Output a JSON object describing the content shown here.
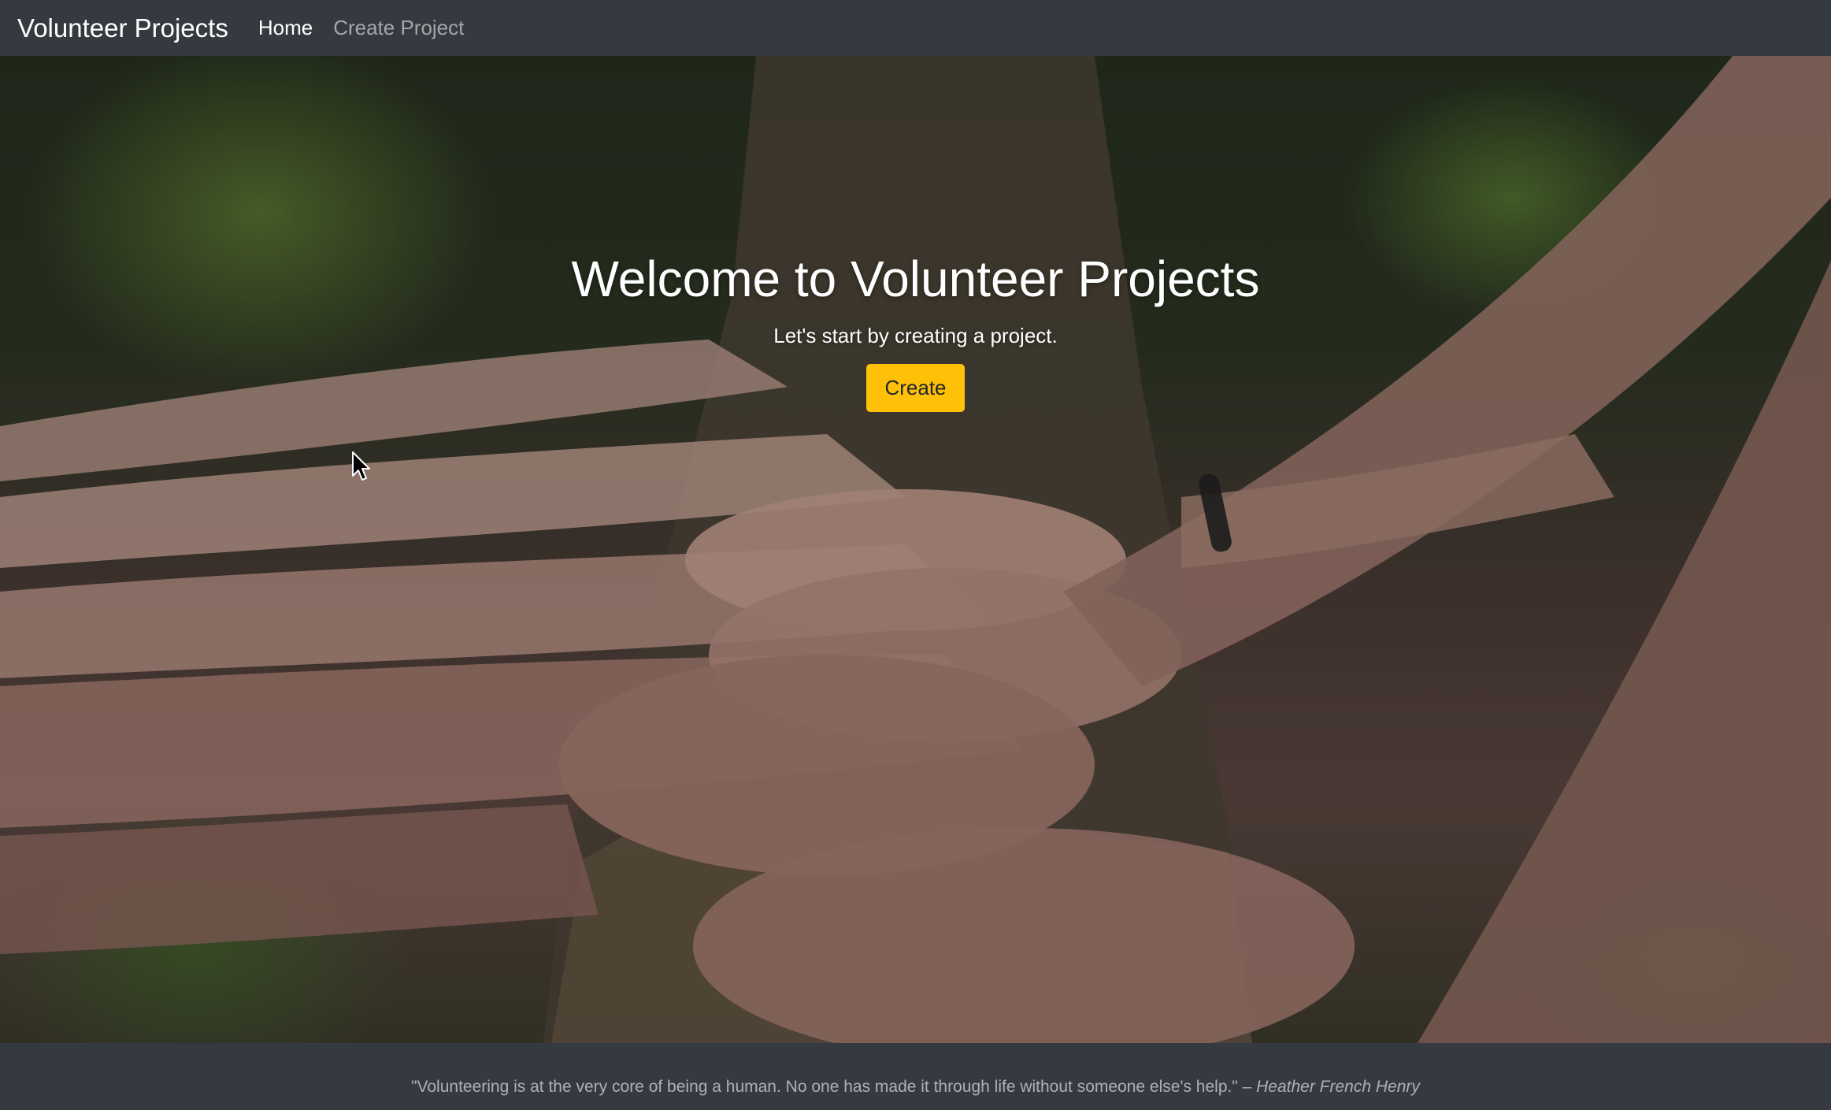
{
  "navbar": {
    "brand": "Volunteer Projects",
    "links": [
      {
        "label": "Home",
        "active": true
      },
      {
        "label": "Create Project",
        "active": false
      }
    ]
  },
  "hero": {
    "title": "Welcome to Volunteer Projects",
    "subtitle": "Let's start by creating a project.",
    "button_label": "Create",
    "button_color": "#ffc107",
    "background_description": "Photo of many hands resting together on a tree log in a green forest"
  },
  "footer": {
    "quote": "\"Volunteering is at the very core of being a human. No one has made it through life without someone else's help.\" – ",
    "author": "Heather French Henry"
  },
  "colors": {
    "navbar_bg": "#343a40",
    "footer_bg": "#343a40",
    "accent": "#ffc107"
  }
}
